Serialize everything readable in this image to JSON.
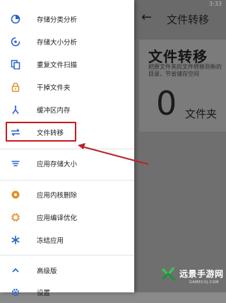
{
  "background": {
    "status": "3:33",
    "back_glyph": "←",
    "title": "文件转移",
    "card_title": "文件转移",
    "card_desc": "把原文件夹的文件转移到新的目录，节省储存空间",
    "big_number": "0",
    "unit": "文件夹"
  },
  "drawer": {
    "items": [
      {
        "label": "存储分类分析",
        "icon": "category-pie-icon"
      },
      {
        "label": "存储大小分析",
        "icon": "size-analysis-icon"
      },
      {
        "label": "重复文件扫描",
        "icon": "duplicate-files-icon"
      },
      {
        "label": "干掉文件夹",
        "icon": "lock-icon"
      },
      {
        "label": "缓冲区内存",
        "icon": "cache-icon"
      },
      {
        "label": "文件转移",
        "icon": "transfer-arrows-icon"
      },
      {
        "label": "应用存储大小",
        "icon": "storage-lines-icon"
      },
      {
        "label": "应用内核删除",
        "icon": "app-core-icon"
      },
      {
        "label": "应用编译优化",
        "icon": "chip-icon"
      },
      {
        "label": "冻结应用",
        "icon": "snowflake-icon"
      },
      {
        "label": "高级版",
        "icon": "chevron-up-icon"
      },
      {
        "label": "设置",
        "icon": "gear-icon"
      }
    ]
  },
  "watermark": {
    "text": "远景手游网",
    "sub": "GAMECXJ.COM"
  },
  "colors": {
    "accent": "#2a63c9",
    "highlight": "#c8191d",
    "overlay": "#6f6f6f"
  }
}
